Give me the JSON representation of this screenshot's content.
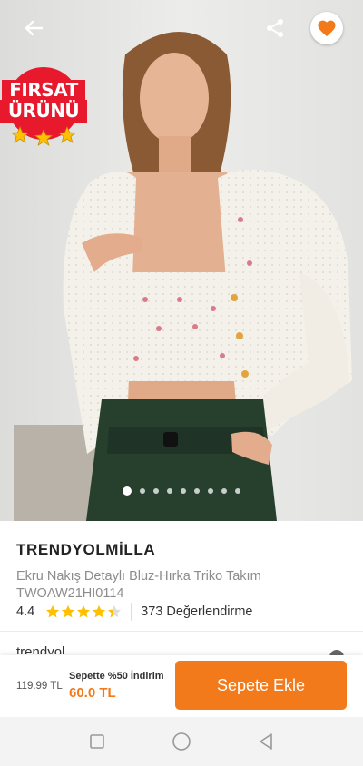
{
  "product": {
    "brand": "TRENDYOLMİLLA",
    "name": "Ekru Nakış Detaylı Bluz-Hırka Triko Takım",
    "code": "TWOAW21HI0114",
    "rating": "4.4",
    "stars": 4.4,
    "review_count": "373 Değerlendirme"
  },
  "badge": {
    "line1": "FIRSAT",
    "line2": "ÜRÜNÜ"
  },
  "gallery": {
    "total_images": 9,
    "active_index": 0
  },
  "seller_peek": "trendyol",
  "buy_bar": {
    "old_price": "119.99 TL",
    "discount_label": "Sepette %50 İndirim",
    "new_price": "60.0 TL",
    "add_button": "Sepete Ekle"
  },
  "icons": {
    "back": "arrow-left-icon",
    "share": "share-icon",
    "favorite": "heart-icon",
    "nav_recents": "square-icon",
    "nav_home": "circle-icon",
    "nav_back": "triangle-back-icon"
  },
  "colors": {
    "accent": "#f27a1a",
    "badge_red": "#e8192c",
    "star": "#ffc000"
  }
}
